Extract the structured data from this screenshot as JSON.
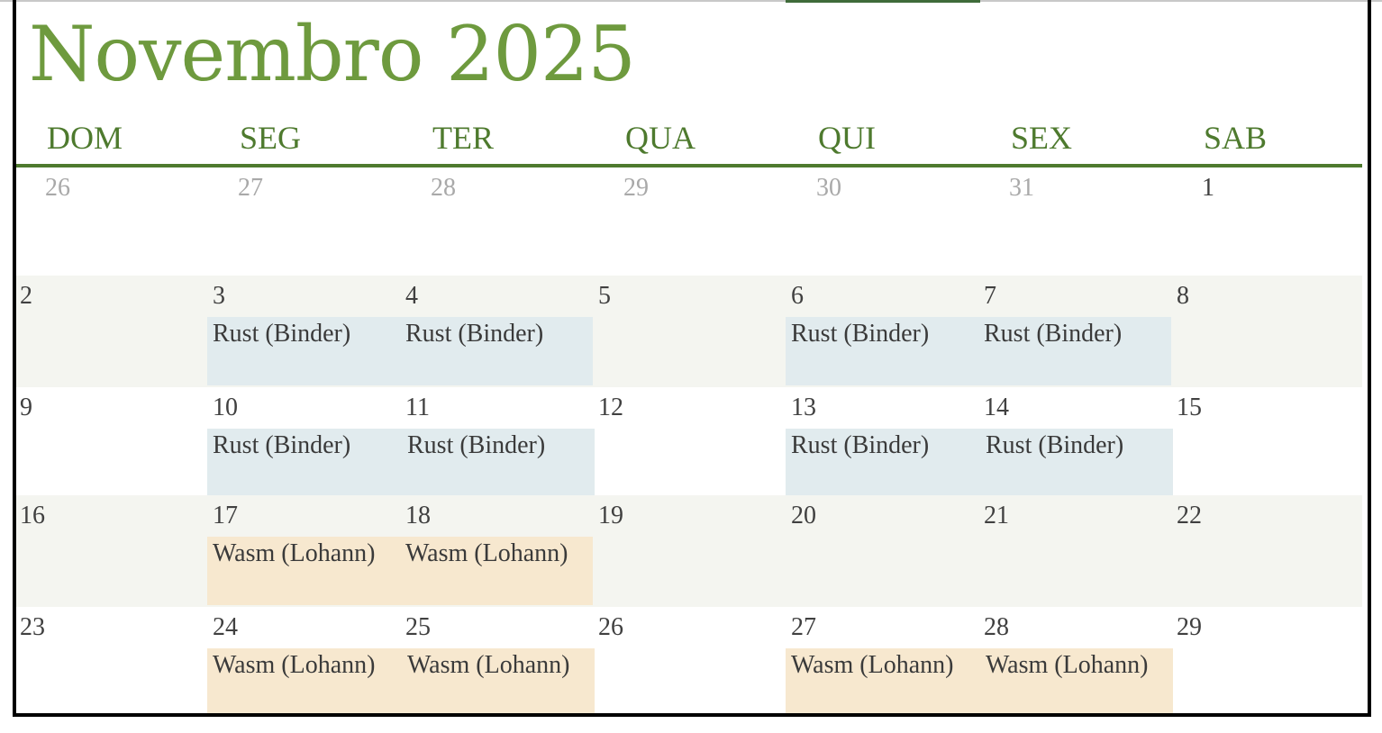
{
  "calendar": {
    "title": "Novembro 2025",
    "weekdays": [
      "DOM",
      "SEG",
      "TER",
      "QUA",
      "QUI",
      "SEX",
      "SAB"
    ],
    "weeks": [
      {
        "days": [
          "26",
          "27",
          "28",
          "29",
          "30",
          "31",
          "1"
        ],
        "events": [
          "",
          "",
          "",
          "",
          "",
          "",
          ""
        ]
      },
      {
        "days": [
          "2",
          "3",
          "4",
          "5",
          "6",
          "7",
          "8"
        ],
        "events": [
          "",
          "Rust (Binder)",
          "Rust (Binder)",
          "",
          "Rust (Binder)",
          "Rust (Binder)",
          ""
        ]
      },
      {
        "days": [
          "9",
          "10",
          "11",
          "12",
          "13",
          "14",
          "15"
        ],
        "events": [
          "",
          "Rust (Binder)",
          "Rust (Binder)",
          "",
          "Rust (Binder)",
          "Rust (Binder)",
          ""
        ]
      },
      {
        "days": [
          "16",
          "17",
          "18",
          "19",
          "20",
          "21",
          "22"
        ],
        "events": [
          "",
          "Wasm (Lohann)",
          "Wasm (Lohann)",
          "",
          "",
          "",
          ""
        ]
      },
      {
        "days": [
          "23",
          "24",
          "25",
          "26",
          "27",
          "28",
          "29"
        ],
        "events": [
          "",
          "Wasm (Lohann)",
          "Wasm (Lohann)",
          "",
          "Wasm (Lohann)",
          "Wasm (Lohann)",
          ""
        ]
      }
    ]
  },
  "colors": {
    "title": "#6e9a3e",
    "weekday": "#4e7a2e",
    "rust_event": "#e1ebee",
    "wasm_event": "#f7e8cf",
    "shaded_row": "#f4f5f0",
    "muted_day": "#a9a9a9"
  }
}
